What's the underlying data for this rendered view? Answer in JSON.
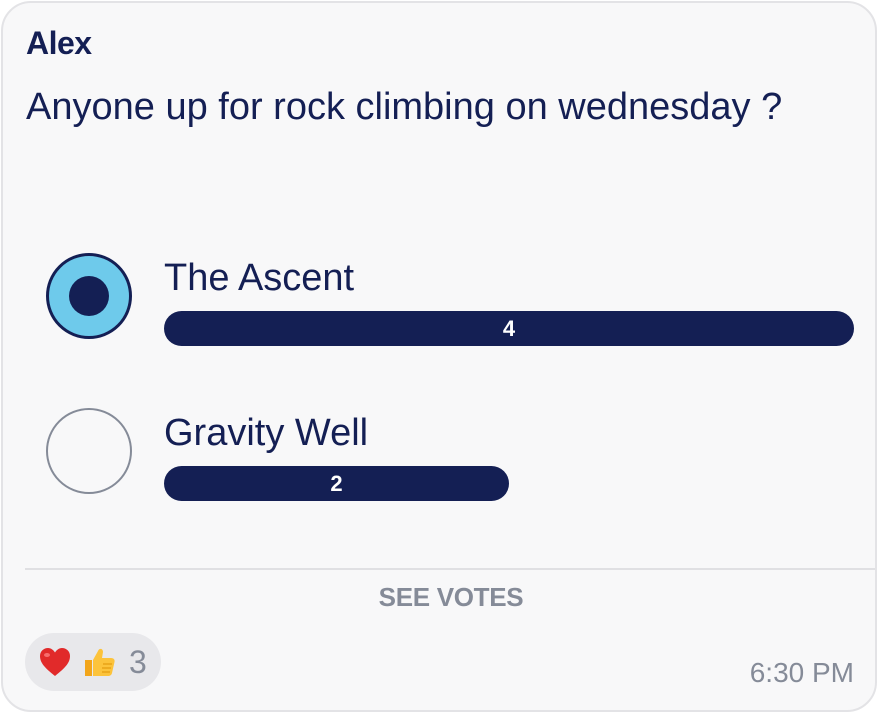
{
  "message": {
    "author": "Alex",
    "question": "Anyone up for rock climbing on wednesday ?",
    "timestamp": "6:30 PM"
  },
  "poll": {
    "options": [
      {
        "label": "The Ascent",
        "votes": "4",
        "selected": true,
        "fill_fraction": 1.0
      },
      {
        "label": "Gravity Well",
        "votes": "2",
        "selected": false,
        "fill_fraction": 0.5
      }
    ],
    "see_votes_label": "SEE VOTES"
  },
  "reactions": {
    "icons": [
      "heart-icon",
      "thumbs-up-icon"
    ],
    "count": "3"
  },
  "colors": {
    "primary": "#141f54",
    "accent": "#6ecaeb",
    "muted": "#858b98",
    "card_bg": "#f8f8f9"
  }
}
